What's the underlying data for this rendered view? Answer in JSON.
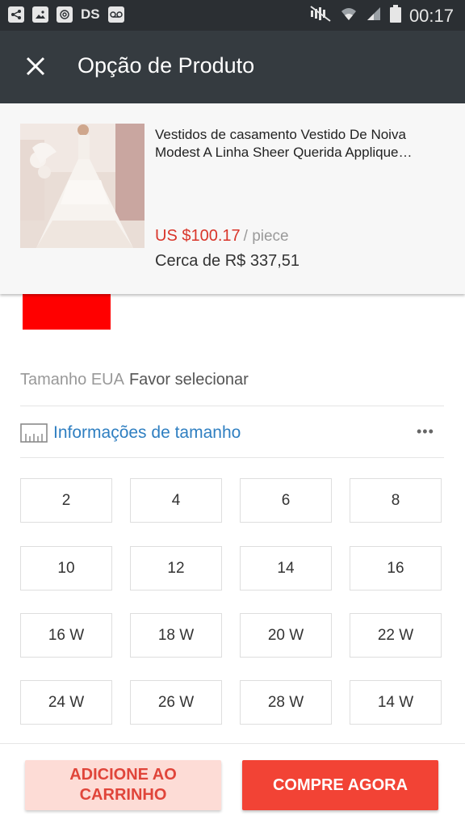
{
  "status_bar": {
    "time": "00:17",
    "left_icons": [
      "share-icon",
      "image-icon",
      "at-icon",
      "ds-icon",
      "voicemail-icon"
    ],
    "ds_label": "DS",
    "right_icons": [
      "mute-icon",
      "wifi-icon",
      "signal-icon",
      "battery-icon"
    ]
  },
  "app_bar": {
    "title": "Opção de Produto",
    "close_icon": "close-icon"
  },
  "product": {
    "name": "Vestidos de casamento Vestido De Noiva Modest A Linha Sheer Querida Applique…",
    "price": "US $100.17",
    "unit": "/ piece",
    "approx_price": "Cerca de R$ 337,51",
    "selected_color": "#ff0000"
  },
  "size": {
    "label": "Tamanho EUA",
    "value": "Favor selecionar",
    "info_link": "Informações de tamanho",
    "more": "•••",
    "options": [
      "2",
      "4",
      "6",
      "8",
      "10",
      "12",
      "14",
      "16",
      "16 W",
      "18 W",
      "20 W",
      "22 W",
      "24 W",
      "26 W",
      "28 W",
      "14 W"
    ]
  },
  "actions": {
    "add_to_cart": "ADICIONE AO CARRINHO",
    "buy_now": "COMPRE AGORA"
  },
  "colors": {
    "app_bar": "#353b40",
    "price": "#d9362b",
    "link": "#2f7fc1",
    "buy_button": "#f24335",
    "cart_button": "#fddcd6"
  }
}
